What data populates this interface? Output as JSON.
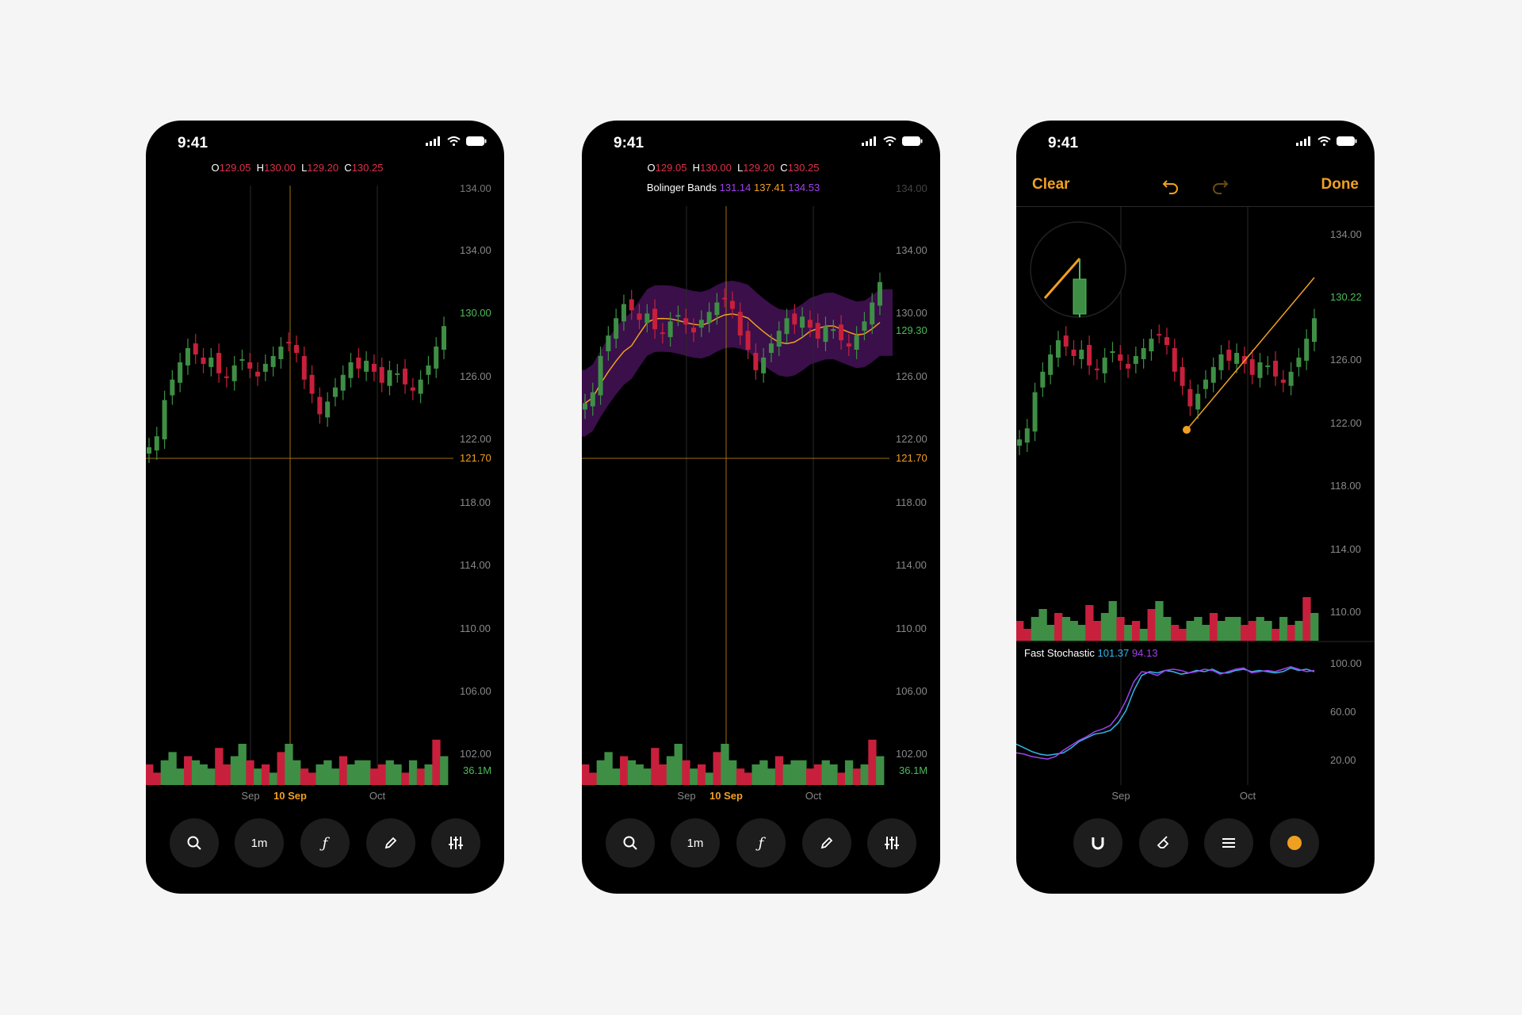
{
  "status_time": "9:41",
  "panel1": {
    "ohlc": {
      "o_label": "O",
      "o": "129.05",
      "h_label": "H",
      "h": "130.00",
      "l_label": "L",
      "l": "129.20",
      "c_label": "C",
      "c": "130.25"
    },
    "price_labels": [
      "134.00",
      "134.00",
      "130.00",
      "126.00",
      "122.00",
      "121.70",
      "118.00",
      "114.00",
      "110.00",
      "106.00",
      "102.00",
      "36.1M"
    ],
    "x_labels": [
      "Sep",
      "10 Sep",
      "Oct"
    ],
    "toolbar": {
      "interval_label": "1m"
    }
  },
  "panel2": {
    "ohlc": {
      "o_label": "O",
      "o": "129.05",
      "h_label": "H",
      "h": "130.00",
      "l_label": "L",
      "l": "129.20",
      "c_label": "C",
      "c": "130.25"
    },
    "bands": {
      "label": "Bolinger Bands",
      "v1": "131.14",
      "v2": "137.41",
      "v3": "134.53"
    },
    "price_labels": [
      "134.00",
      "134.00",
      "130.00",
      "129.30",
      "126.00",
      "122.00",
      "121.70",
      "118.00",
      "114.00",
      "110.00",
      "106.00",
      "102.00",
      "36.1M"
    ],
    "x_labels": [
      "Sep",
      "10 Sep",
      "Oct"
    ],
    "toolbar": {
      "interval_label": "1m"
    }
  },
  "panel3": {
    "topbar": {
      "clear_label": "Clear",
      "done_label": "Done"
    },
    "price_labels": [
      "134.00",
      "130.22",
      "126.00",
      "122.00",
      "118.00",
      "114.00",
      "110.00"
    ],
    "stochastic": {
      "label": "Fast Stochastic",
      "v1": "101.37",
      "v2": "94.13",
      "scale": [
        "100.00",
        "60.00",
        "20.00"
      ]
    },
    "x_labels": [
      "Sep",
      "Oct"
    ]
  },
  "colors": {
    "up": "#3e8f45",
    "down": "#c8203c",
    "accent": "#f0a020",
    "band": "#3a0f4a",
    "purple": "#a040f0",
    "cyan": "#30b8e8"
  },
  "chart_data": {
    "type": "candlestick",
    "closes": [
      121.5,
      122.2,
      124.5,
      125.8,
      126.9,
      127.8,
      127.4,
      126.8,
      127.2,
      126.2,
      125.9,
      126.7,
      127.1,
      126.5,
      126.0,
      126.8,
      127.3,
      127.9,
      128.2,
      127.5,
      125.8,
      124.9,
      123.6,
      124.4,
      125.3,
      126.1,
      126.9,
      126.5,
      127.0,
      126.3,
      125.6,
      126.4,
      126.2,
      125.5,
      125.1,
      125.8,
      126.7,
      127.9,
      129.2
    ],
    "volumes": [
      0.5,
      0.3,
      0.6,
      0.8,
      0.4,
      0.7,
      0.6,
      0.5,
      0.4,
      0.9,
      0.5,
      0.7,
      1.0,
      0.6,
      0.4,
      0.5,
      0.3,
      0.8,
      1.0,
      0.6,
      0.4,
      0.3,
      0.5,
      0.6,
      0.4,
      0.7,
      0.5,
      0.6,
      0.6,
      0.4,
      0.5,
      0.6,
      0.5,
      0.3,
      0.6,
      0.4,
      0.5,
      1.1,
      0.7
    ],
    "stoch_a": [
      35,
      32,
      29,
      27,
      26,
      27,
      28,
      32,
      37,
      40,
      43,
      44,
      46,
      52,
      62,
      78,
      90,
      93,
      92,
      94,
      93,
      91,
      92,
      94,
      93,
      95,
      92,
      92,
      94,
      95,
      93,
      94,
      93,
      92,
      93,
      96,
      94,
      95,
      93
    ],
    "stoch_b": [
      28,
      27,
      25,
      24,
      23,
      25,
      30,
      34,
      38,
      41,
      45,
      47,
      50,
      58,
      70,
      85,
      93,
      92,
      90,
      94,
      95,
      94,
      92,
      93,
      95,
      94,
      91,
      93,
      95,
      96,
      92,
      93,
      94,
      93,
      95,
      97,
      95,
      93,
      94
    ],
    "ylim": [
      100,
      136
    ],
    "crosshair_price": 121.7
  }
}
